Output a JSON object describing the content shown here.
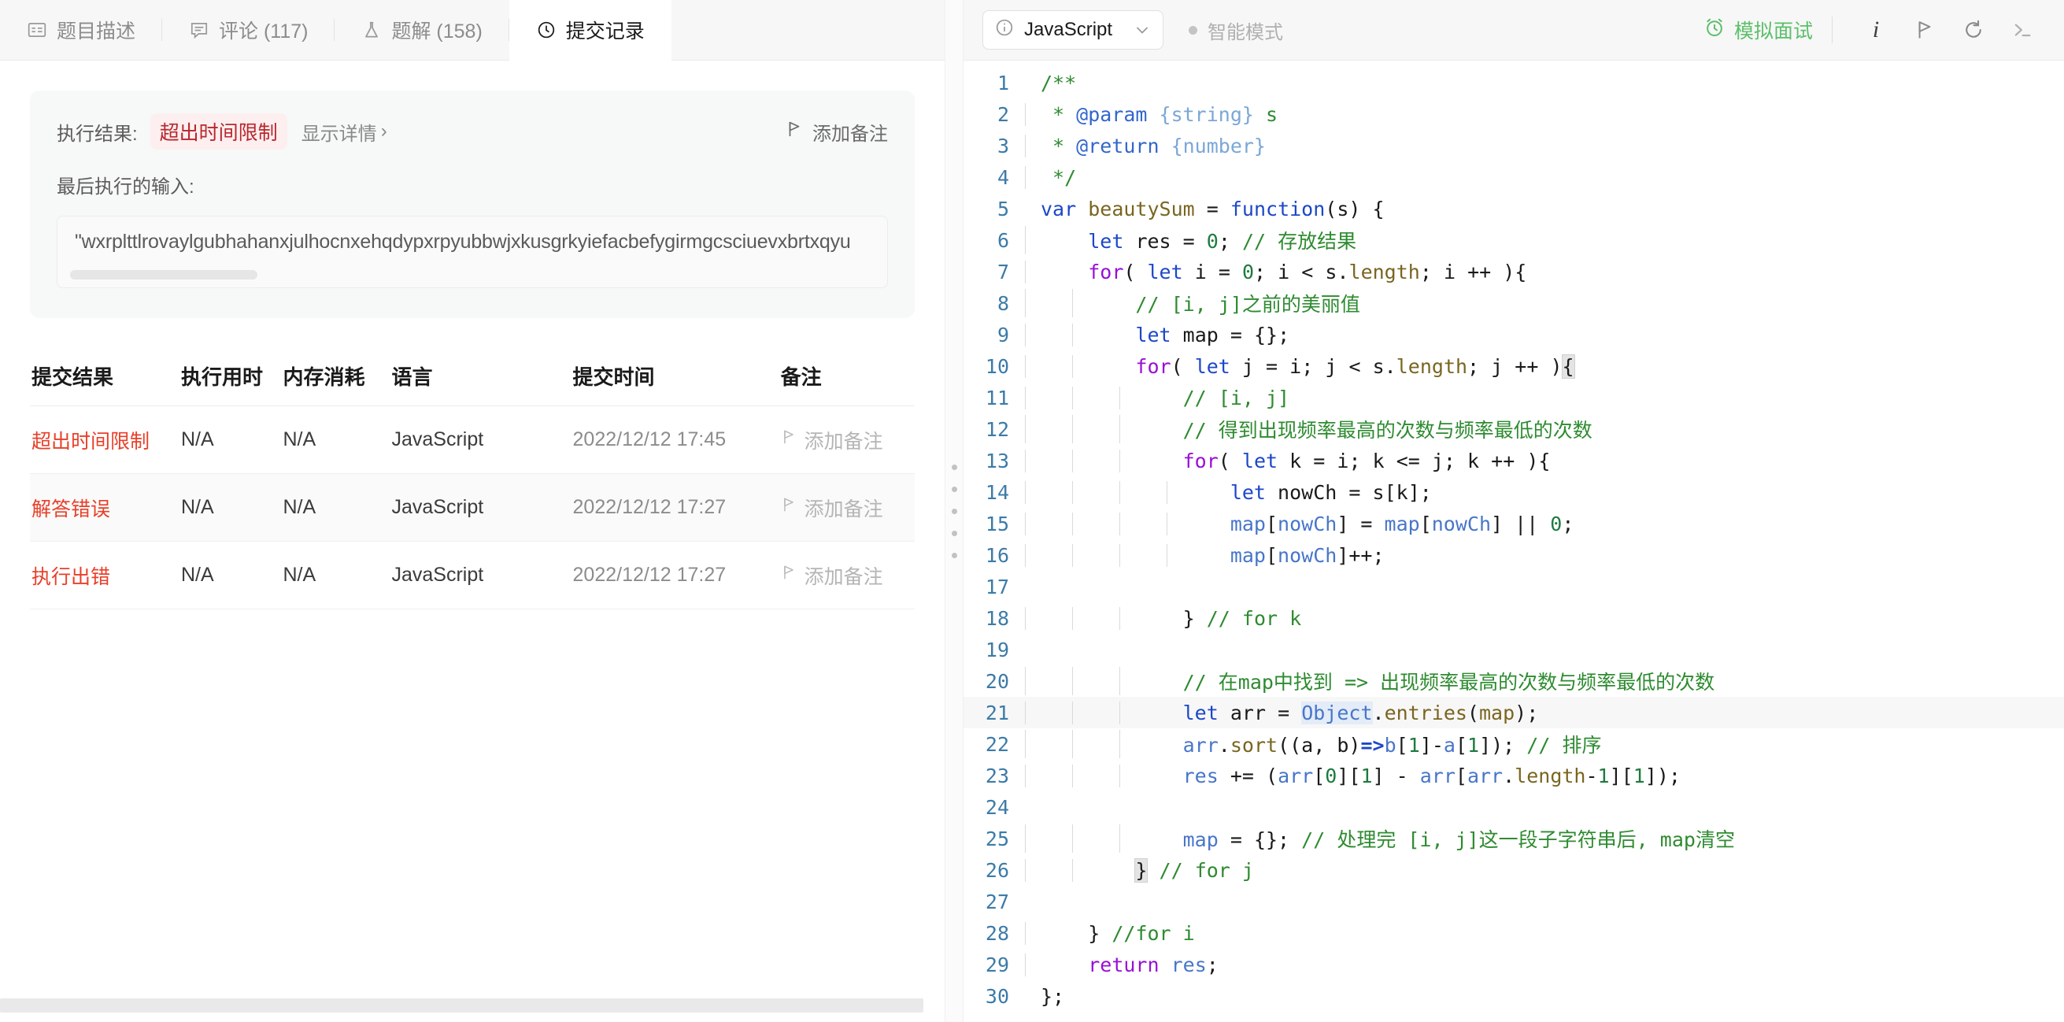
{
  "left": {
    "tabs": [
      {
        "label": "题目描述",
        "icon": "description-icon",
        "active": false
      },
      {
        "label": "评论 (117)",
        "icon": "comment-icon",
        "active": false
      },
      {
        "label": "题解 (158)",
        "icon": "flask-icon",
        "active": false
      },
      {
        "label": "提交记录",
        "icon": "clock-icon",
        "active": true
      }
    ],
    "result": {
      "label": "执行结果:",
      "status": "超出时间限制",
      "status_color": "#b8272d",
      "status_bg": "#fdeff0",
      "detail_link": "显示详情",
      "detail_chevron": "›",
      "add_note": "添加备注",
      "input_label": "最后执行的输入:",
      "input_value": "\"wxrplttlrovaylgubhahanxjulhocnxehqdypxrpyubbwjxkusgrkyiefacbefygirmgcsciuevxbrtxqyu"
    },
    "table": {
      "headers": [
        "提交结果",
        "执行用时",
        "内存消耗",
        "语言",
        "提交时间",
        "备注"
      ],
      "rows": [
        {
          "result": "超出时间限制",
          "runtime": "N/A",
          "memory": "N/A",
          "language": "JavaScript",
          "time": "2022/12/12 17:45",
          "note": "添加备注"
        },
        {
          "result": "解答错误",
          "runtime": "N/A",
          "memory": "N/A",
          "language": "JavaScript",
          "time": "2022/12/12 17:27",
          "note": "添加备注"
        },
        {
          "result": "执行出错",
          "runtime": "N/A",
          "memory": "N/A",
          "language": "JavaScript",
          "time": "2022/12/12 17:27",
          "note": "添加备注"
        }
      ],
      "result_color": "#e8402a"
    }
  },
  "right": {
    "toolbar": {
      "language": "JavaScript",
      "language_icon": "info-circle-icon",
      "chevron": "chevron-down-icon",
      "smart_mode": "智能模式",
      "mock_interview": "模拟面试",
      "mock_interview_color": "#5bbf6a",
      "icons": [
        "info-italic-icon",
        "flag-icon",
        "reset-icon",
        "console-icon"
      ]
    },
    "editor": {
      "line_count": 30,
      "active_line": 21,
      "lines": [
        {
          "n": 1,
          "text": "/**"
        },
        {
          "n": 2,
          "text": " * @param {string} s"
        },
        {
          "n": 3,
          "text": " * @return {number}"
        },
        {
          "n": 4,
          "text": " */"
        },
        {
          "n": 5,
          "text": "var beautySum = function(s) {"
        },
        {
          "n": 6,
          "text": "    let res = 0; // 存放结果"
        },
        {
          "n": 7,
          "text": "    for( let i = 0; i < s.length; i ++ ){"
        },
        {
          "n": 8,
          "text": "        // [i, j]之前的美丽值"
        },
        {
          "n": 9,
          "text": "        let map = {};"
        },
        {
          "n": 10,
          "text": "        for( let j = i; j < s.length; j ++ ){"
        },
        {
          "n": 11,
          "text": "            // [i, j]"
        },
        {
          "n": 12,
          "text": "            // 得到出现频率最高的次数与频率最低的次数"
        },
        {
          "n": 13,
          "text": "            for( let k = i; k <= j; k ++ ){"
        },
        {
          "n": 14,
          "text": "                let nowCh = s[k];"
        },
        {
          "n": 15,
          "text": "                map[nowCh] = map[nowCh] || 0;"
        },
        {
          "n": 16,
          "text": "                map[nowCh]++;"
        },
        {
          "n": 17,
          "text": ""
        },
        {
          "n": 18,
          "text": "            } // for k"
        },
        {
          "n": 19,
          "text": ""
        },
        {
          "n": 20,
          "text": "            // 在map中找到 => 出现频率最高的次数与频率最低的次数"
        },
        {
          "n": 21,
          "text": "            let arr = Object.entries(map);"
        },
        {
          "n": 22,
          "text": "            arr.sort((a, b)=>b[1]-a[1]); // 排序"
        },
        {
          "n": 23,
          "text": "            res += (arr[0][1] - arr[arr.length-1][1]);"
        },
        {
          "n": 24,
          "text": ""
        },
        {
          "n": 25,
          "text": "            map = {}; // 处理完 [i, j]这一段子字符串后, map清空"
        },
        {
          "n": 26,
          "text": "        } // for j"
        },
        {
          "n": 27,
          "text": ""
        },
        {
          "n": 28,
          "text": "    } //for i"
        },
        {
          "n": 29,
          "text": "    return res;"
        },
        {
          "n": 30,
          "text": "};"
        }
      ]
    }
  }
}
